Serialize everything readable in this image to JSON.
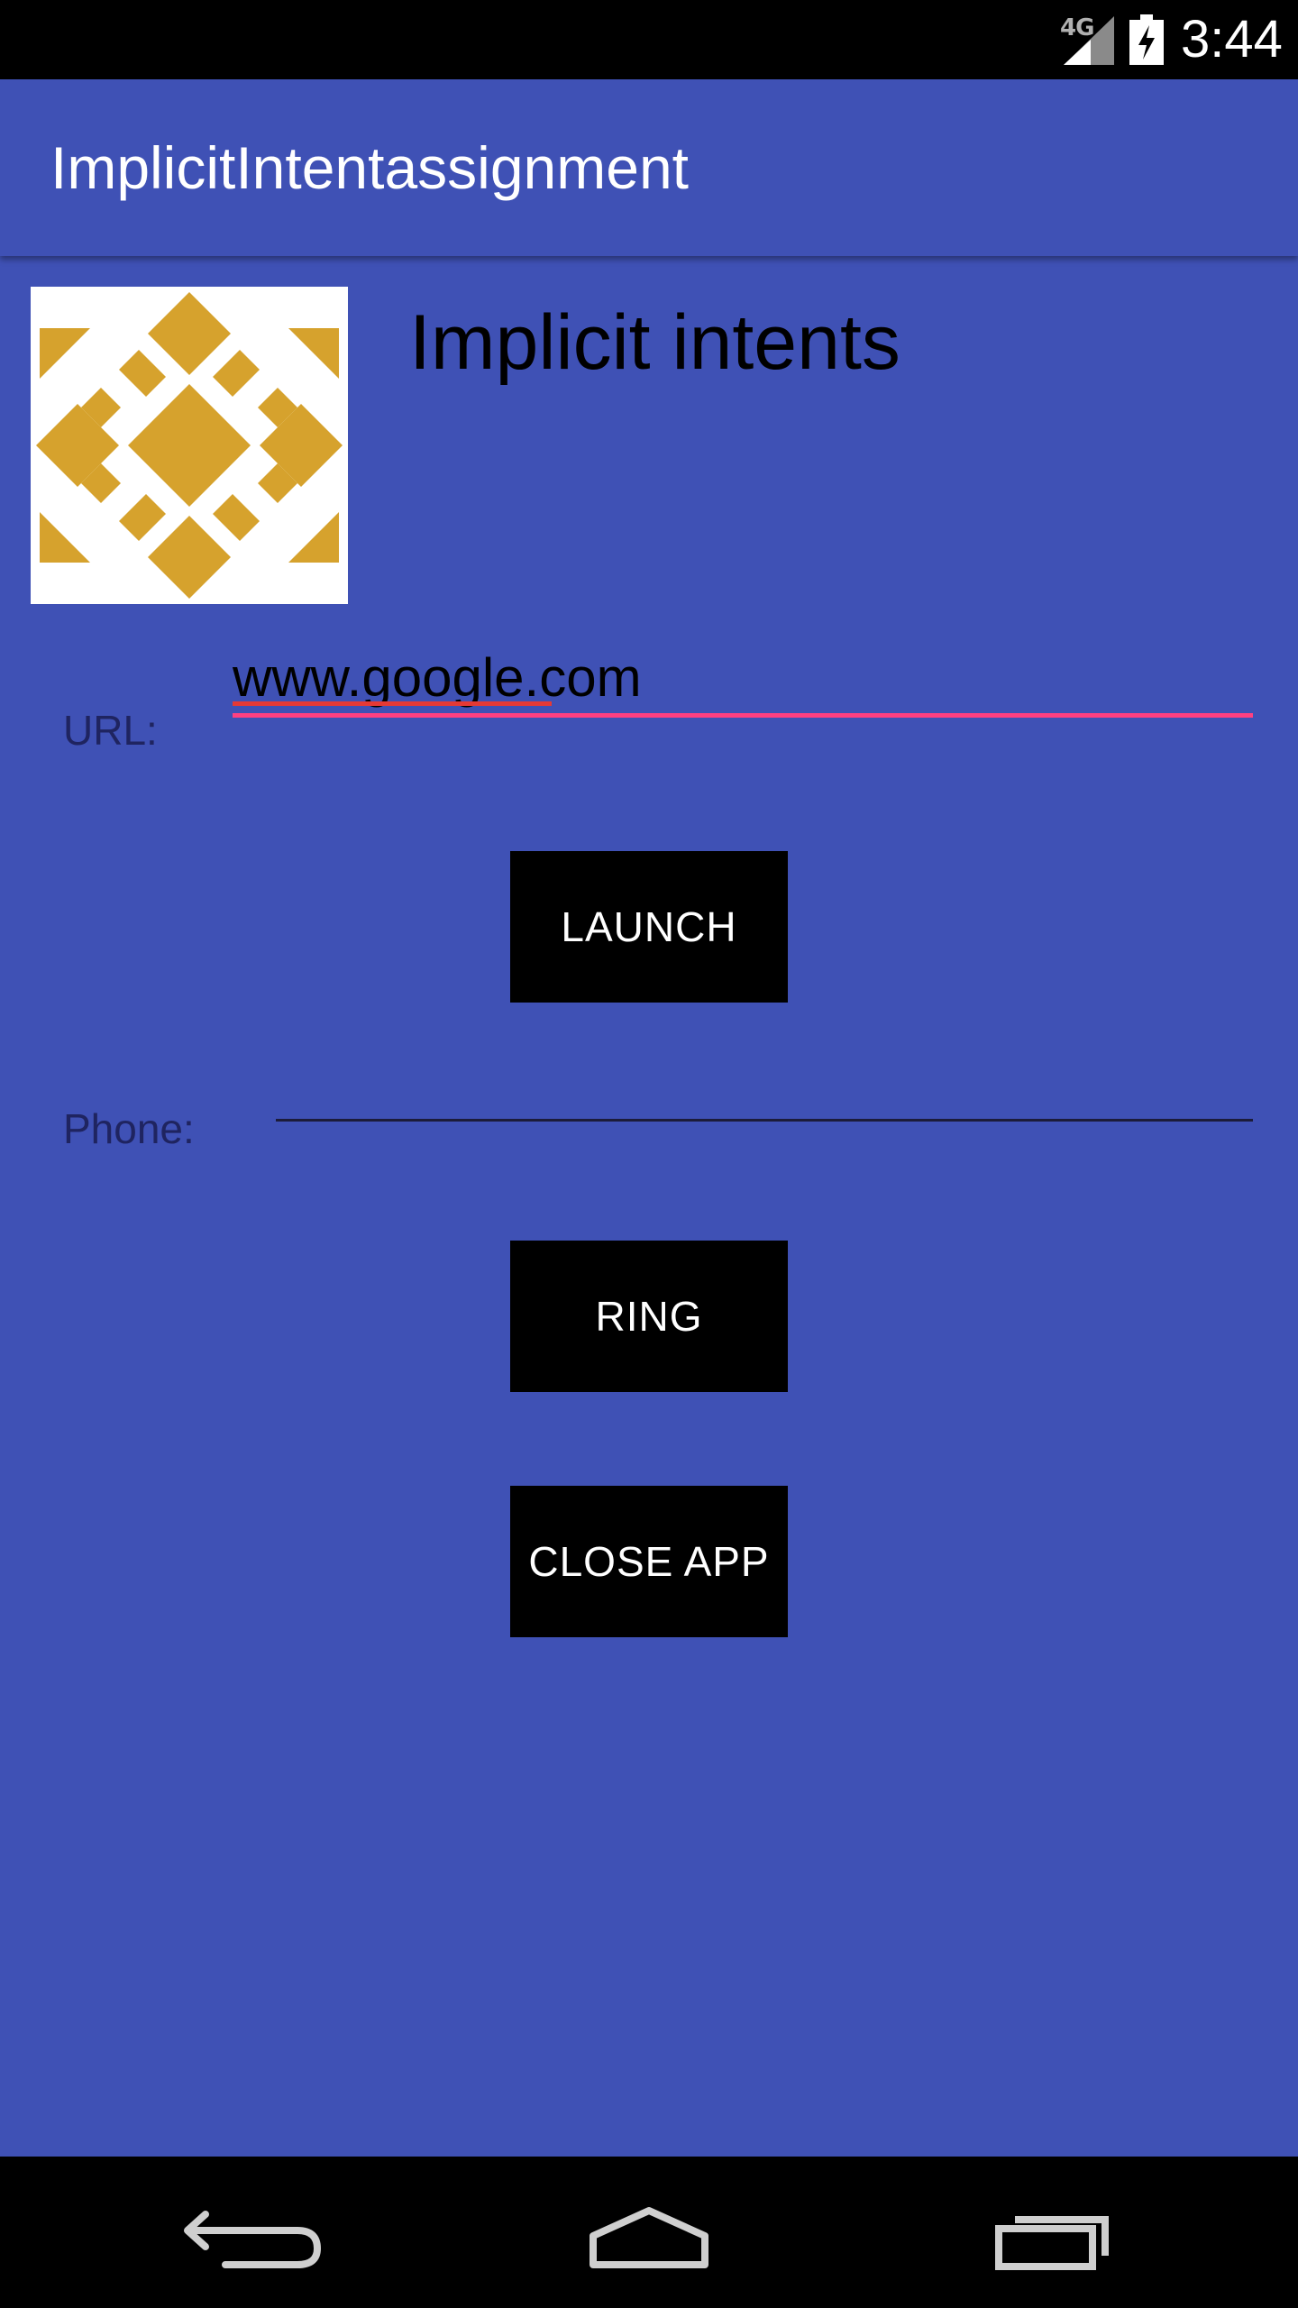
{
  "status_bar": {
    "network": "4G",
    "time": "3:44"
  },
  "app_bar": {
    "title": "ImplicitIntentassignment"
  },
  "main": {
    "heading": "Implicit intents",
    "url": {
      "label": "URL:",
      "value": "www.google.com"
    },
    "launch_label": "LAUNCH",
    "phone": {
      "label": "Phone:",
      "value": ""
    },
    "ring_label": "RING",
    "close_label": "CLOSE APP"
  },
  "colors": {
    "primary": "#3f51b5",
    "accent": "#ff4081",
    "button": "#000000",
    "logo_gold": "#d6a22d"
  },
  "icons": {
    "signal": "signal-icon",
    "battery": "battery-charging-icon",
    "logo": "diamond-tile-logo",
    "back": "back-icon",
    "home": "home-icon",
    "recents": "recents-icon"
  }
}
